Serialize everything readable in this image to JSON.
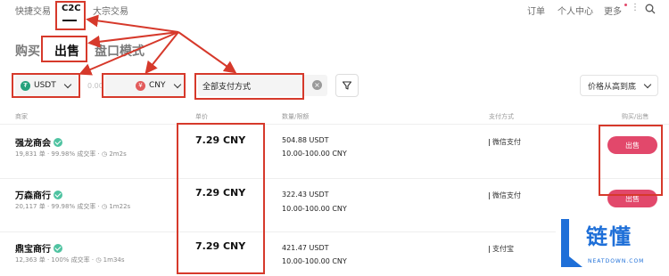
{
  "topnav": {
    "items": [
      "快捷交易",
      "C2C",
      "大宗交易"
    ],
    "right": [
      "订单",
      "个人中心",
      "更多"
    ]
  },
  "tabs": [
    "购买",
    "出售",
    "盘口模式"
  ],
  "filters": {
    "coin": "USDT",
    "coin_color": "#27a17c",
    "amount_placeholder": "0.00",
    "fiat": "CNY",
    "fiat_color": "#e25c5c",
    "payment": "全部支付方式",
    "clear_symbol": "×",
    "sort": "价格从高到底"
  },
  "table": {
    "headers": [
      "商家",
      "单价",
      "数量/限额",
      "支付方式",
      "购买/出售"
    ],
    "rows": [
      {
        "merchant": "强龙商会",
        "orders": "19,831 单",
        "rate": "99.98% 成交率",
        "time": "2m2s",
        "price": "7.29 CNY",
        "qty": "504.88 USDT",
        "limit": "10.00-100.00 CNY",
        "payment": "微信支付",
        "action": "出售"
      },
      {
        "merchant": "万森商行",
        "orders": "20,117 单",
        "rate": "99.98% 成交率",
        "time": "1m22s",
        "price": "7.29 CNY",
        "qty": "322.43 USDT",
        "limit": "10.00-100.00 CNY",
        "payment": "微信支付",
        "action": "出售"
      },
      {
        "merchant": "鼎宝商行",
        "orders": "12,363 单",
        "rate": "100% 成交率",
        "time": "1m34s",
        "price": "7.29 CNY",
        "qty": "421.47 USDT",
        "limit": "10.00-100.00 CNY",
        "payment": "支付宝",
        "action": "出售"
      }
    ]
  },
  "watermark": {
    "cn": "链懂",
    "en": "NEATDOWN.COM"
  },
  "colors": {
    "annotation": "#d6392b",
    "sell": "#e2486b",
    "verified": "#4fc3a1",
    "brand": "#1e6fd8"
  }
}
